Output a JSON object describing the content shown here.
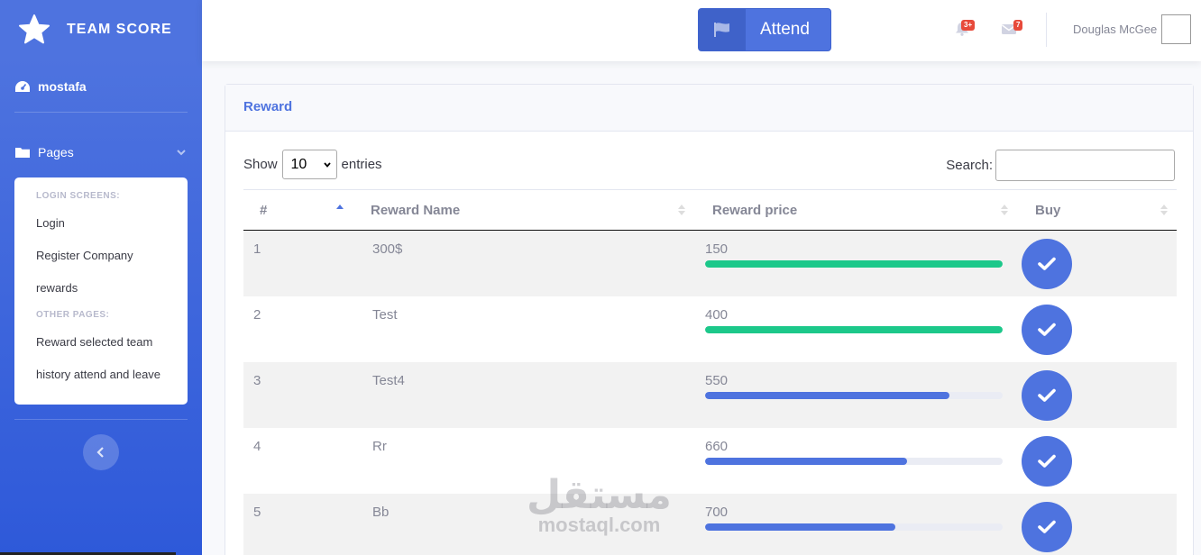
{
  "brand": {
    "name": "TEAM SCORE",
    "icon": "star-icon"
  },
  "sidebar": {
    "dashboard_label": "mostafa",
    "pages_label": "Pages",
    "sections": [
      {
        "header": "LOGIN SCREENS:",
        "items": [
          "Login",
          "Register Company",
          "rewards"
        ]
      },
      {
        "header": "OTHER PAGES:",
        "items": [
          "Reward selected team",
          "history attend and leave"
        ]
      }
    ]
  },
  "topbar": {
    "attend_label": "Attend",
    "alerts_badge": "3+",
    "messages_badge": "7",
    "user_name": "Douglas McGee"
  },
  "card": {
    "title": "Reward",
    "show_label": "Show",
    "entries_value": "10",
    "entries_label": "entries",
    "search_label": "Search:",
    "columns": [
      "#",
      "Reward Name",
      "Reward price",
      "Buy"
    ],
    "rows": [
      {
        "num": "1",
        "name": "300$",
        "price": "150",
        "progress": 1.0,
        "color": "#1cc88a"
      },
      {
        "num": "2",
        "name": "Test",
        "price": "400",
        "progress": 1.0,
        "color": "#1cc88a"
      },
      {
        "num": "3",
        "name": "Test4",
        "price": "550",
        "progress": 0.82,
        "color": "#4e73df"
      },
      {
        "num": "4",
        "name": "Rr",
        "price": "660",
        "progress": 0.68,
        "color": "#4e73df"
      },
      {
        "num": "5",
        "name": "Bb",
        "price": "700",
        "progress": 0.64,
        "color": "#4e73df"
      }
    ]
  },
  "watermark": {
    "arabic": "مستقل",
    "latin": "mostaql.com"
  },
  "colors": {
    "primary": "#4e73df",
    "success": "#1cc88a",
    "danger": "#e74a3b"
  }
}
